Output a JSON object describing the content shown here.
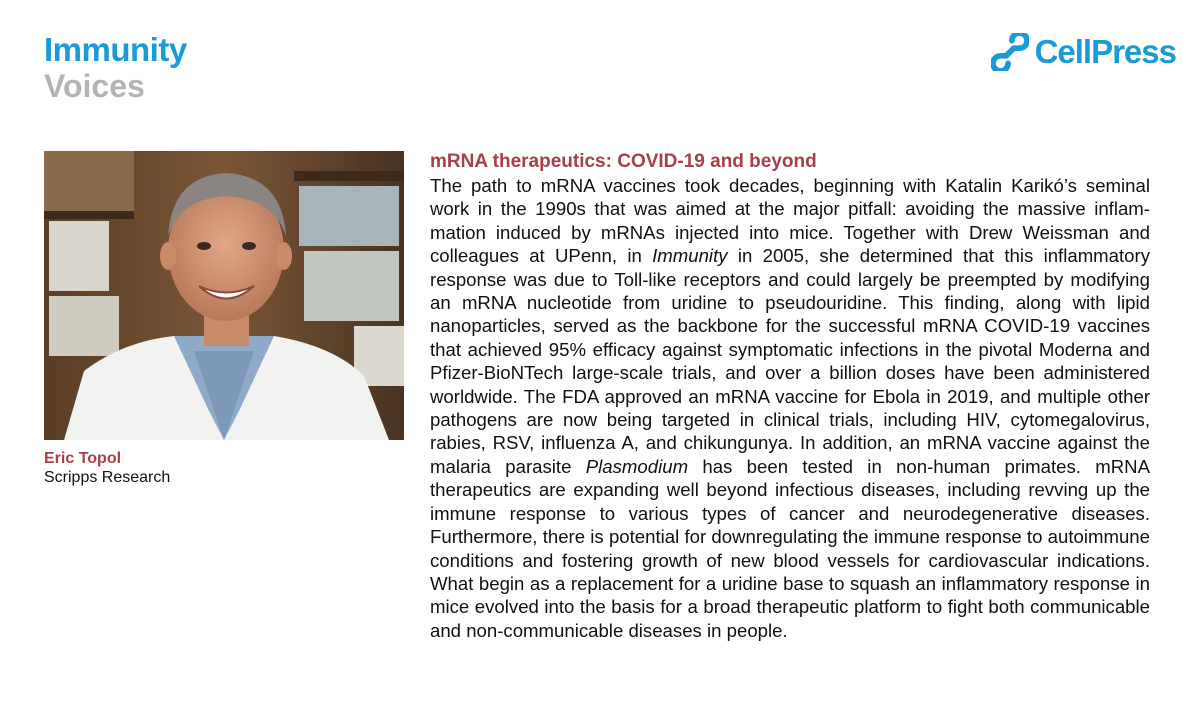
{
  "header": {
    "journal": "Immunity",
    "section": "Voices",
    "publisher": "CellPress",
    "publisher_icon": "cellpress-logo-icon",
    "accent_color": "#1a9ad6"
  },
  "author": {
    "name": "Eric Topol",
    "affiliation": "Scripps Research",
    "photo_alt": "author-photo",
    "name_color": "#a8404a"
  },
  "article": {
    "title": "mRNA therapeutics: COVID-19 and beyond",
    "body": [
      "The path to mRNA vaccines took decades, beginning with Katalin Karikó’s seminal work in the 1990s that was aimed at the major pitfall: avoiding the massive inflam­mation induced by mRNAs injected into mice. Together with Drew Weissman and colleagues at UPenn, in ",
      "Immunity",
      " in 2005, she determined that this inflammatory response was due to Toll-like receptors and could largely be preempted by modi­fying an mRNA nucleotide from uridine to pseudouridine. This finding, along with lipid nanoparticles, served as the backbone for the successful mRNA COVID-19 vaccines that achieved 95% efficacy against symptomatic infections in the pivotal Moderna and Pfizer-BioNTech large-scale trials, and over a billion doses have been administered worldwide. The FDA approved an mRNA vaccine for Ebola in 2019, and multiple other pathogens are now being targeted in clinical trials, including HIV, cytomegalovirus, rabies, RSV, influenza A, and chikungunya. In addi­tion, an mRNA vaccine against the malaria parasite ",
      "Plasmodium",
      " has been tested in non-human primates. mRNA therapeutics are expanding well beyond infectious diseases, including revving up the immune response to various types of cancer and neurodegenerative diseases. Furthermore, there is potential for downregulating the immune response to autoimmune conditions and fostering growth of new blood vessels for cardiovascular indications. What begin as a replacement for a uridine base to squash an inflammatory response in mice evolved into the basis for a broad therapeutic platform to fight both communicable and non-communicable diseases in people."
    ]
  }
}
